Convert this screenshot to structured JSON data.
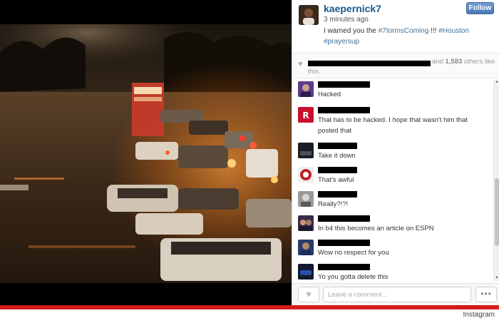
{
  "post": {
    "username": "kaepernick7",
    "time": "3 minutes ago",
    "caption_text": "I warned you the ",
    "hashtags": [
      "#7tormsComing",
      "#Houston",
      "#prayersup"
    ],
    "caption_bang": " !!! ",
    "follow_label": "Follow"
  },
  "likes": {
    "and_text": "and",
    "count": "1,583",
    "others_text": "others like",
    "tail": "this."
  },
  "comments": [
    {
      "text": "Hacked",
      "avatar": "purple-portrait"
    },
    {
      "text": "That has to be hacked. I hope that wasn't him that posted that",
      "avatar": "rockets-logo"
    },
    {
      "text": "Take it down",
      "avatar": "dark-scene"
    },
    {
      "text": "That's awful",
      "avatar": "red-white-logo"
    },
    {
      "text": "Really?!?!",
      "avatar": "gray-portrait"
    },
    {
      "text": "In b4 this becomes an article on ESPN",
      "avatar": "couple-photo"
    },
    {
      "text": "Wow no respect for you",
      "avatar": "blue-portrait"
    },
    {
      "text": "Yo you gotta delete this",
      "avatar": "blue-car"
    }
  ],
  "comment_bar": {
    "placeholder": "Leave a comment...",
    "more_label": "•••"
  },
  "footer": {
    "credit": "Instagram",
    "accent_color": "#d31b1b"
  }
}
